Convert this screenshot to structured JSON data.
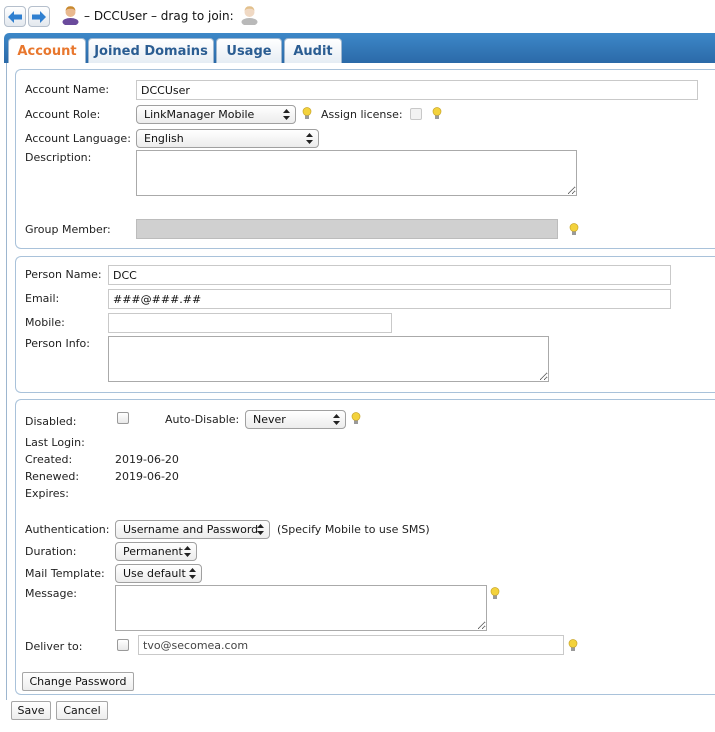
{
  "header": {
    "title_prefix": "– DCCUser  – drag to join:"
  },
  "tabs": [
    {
      "label": "Account",
      "active": true
    },
    {
      "label": "Joined Domains",
      "active": false
    },
    {
      "label": "Usage",
      "active": false
    },
    {
      "label": "Audit",
      "active": false
    }
  ],
  "account": {
    "name_label": "Account Name:",
    "name_value": "DCCUser",
    "role_label": "Account Role:",
    "role_value": "LinkManager Mobile",
    "assign_license_label": "Assign license:",
    "language_label": "Account Language:",
    "language_value": "English",
    "description_label": "Description:",
    "description_value": "",
    "group_member_label": "Group Member:",
    "group_member_value": ""
  },
  "person": {
    "name_label": "Person Name:",
    "name_value": "DCC",
    "email_label": "Email:",
    "email_value": "###@###.##",
    "mobile_label": "Mobile:",
    "mobile_value": "",
    "info_label": "Person Info:",
    "info_value": ""
  },
  "status": {
    "disabled_label": "Disabled:",
    "auto_disable_label": "Auto-Disable:",
    "auto_disable_value": "Never",
    "last_login_label": "Last Login:",
    "last_login_value": "",
    "created_label": "Created:",
    "created_value": "2019-06-20",
    "renewed_label": "Renewed:",
    "renewed_value": "2019-06-20",
    "expires_label": "Expires:",
    "expires_value": "",
    "authentication_label": "Authentication:",
    "authentication_value": "Username and Password",
    "authentication_hint": "(Specify Mobile to use SMS)",
    "duration_label": "Duration:",
    "duration_value": "Permanent",
    "mail_template_label": "Mail Template:",
    "mail_template_value": "Use default",
    "message_label": "Message:",
    "message_value": "",
    "deliver_to_label": "Deliver to:",
    "deliver_to_value": "tvo@secomea.com",
    "change_password_label": "Change Password"
  },
  "footer": {
    "save_label": "Save",
    "cancel_label": "Cancel"
  },
  "colors": {
    "tab_strip": "#2f74b5",
    "active_tab_text": "#e8772e",
    "tab_text": "#2b5d92",
    "panel_border": "#a9c2da",
    "bulb": "#f3d23c"
  },
  "icons": [
    "back-arrow-icon",
    "forward-arrow-icon",
    "user-icon",
    "drag-user-icon",
    "lightbulb-icon",
    "select-arrows-icon"
  ]
}
